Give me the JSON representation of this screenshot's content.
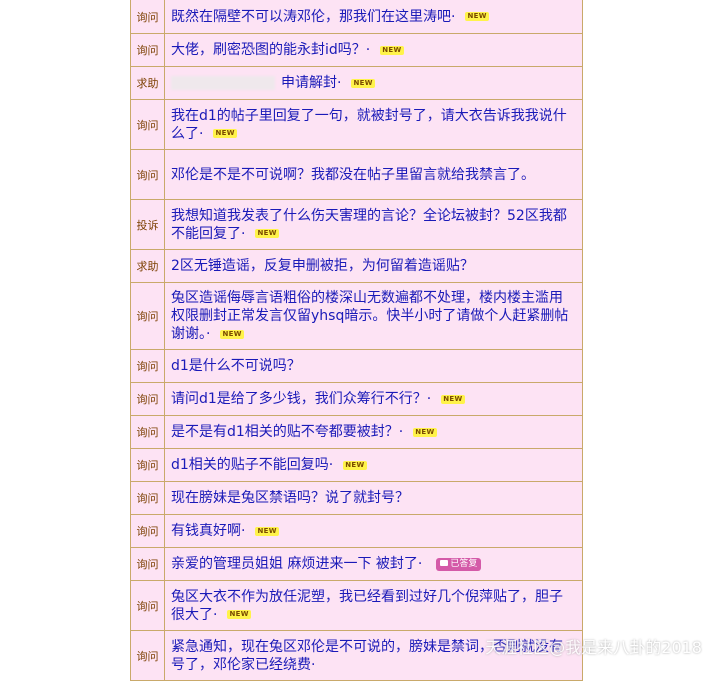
{
  "posts": [
    {
      "tag": "询问",
      "title": "既然在隔壁不可以涛邓伦，那我们在这里涛吧·",
      "new": "NEW",
      "h": 34
    },
    {
      "tag": "询问",
      "title": "大佬，刷密恐图的能永封id吗？·",
      "new": "NEW",
      "h": 33
    },
    {
      "tag": "求助",
      "title": "申请解封·",
      "new": "NEW",
      "h": 33,
      "blur": true
    },
    {
      "tag": "询问",
      "title": "我在d1的帖子里回复了一句，就被封号了，请大衣告诉我我说什么了·",
      "new": "NEW",
      "h": 50
    },
    {
      "tag": "询问",
      "title": "邓伦是不是不可说啊？我都没在帖子里留言就给我禁言了。",
      "new": "",
      "h": 50
    },
    {
      "tag": "投诉",
      "title": "我想知道我发表了什么伤天害理的言论？全论坛被封？52区我都不能回复了·",
      "new": "NEW",
      "h": 50
    },
    {
      "tag": "求助",
      "title": "2区无锤造谣，反复申删被拒，为何留着造谣贴？",
      "new": "",
      "h": 33
    },
    {
      "tag": "询问",
      "title": "兔区造谣侮辱言语粗俗的楼深山无数遍都不处理，楼内楼主滥用权限删封正常发言仅留yhsq暗示。快半小时了请做个人赶紧删帖谢谢。·",
      "new": "NEW",
      "h": 67
    },
    {
      "tag": "询问",
      "title": "d1是什么不可说吗？",
      "new": "",
      "h": 33
    },
    {
      "tag": "询问",
      "title": "请问d1是给了多少钱，我们众筹行不行？·",
      "new": "NEW",
      "h": 33
    },
    {
      "tag": "询问",
      "title": "是不是有d1相关的贴不夸都要被封？·",
      "new": "NEW",
      "h": 33
    },
    {
      "tag": "询问",
      "title": "d1相关的贴子不能回复吗·",
      "new": "NEW",
      "h": 33
    },
    {
      "tag": "询问",
      "title": "现在膀妹是兔区禁语吗？说了就封号？",
      "new": "",
      "h": 33
    },
    {
      "tag": "询问",
      "title": "有钱真好啊·",
      "new": "NEW",
      "h": 33
    },
    {
      "tag": "询问",
      "title": "亲爱的管理员姐姐 麻烦进来一下 被封了·",
      "new": "",
      "answered": "已答复",
      "h": 33
    },
    {
      "tag": "询问",
      "title": "兔区大衣不作为放任泥塑，我已经看到过好几个倪萍贴了，胆子很大了·",
      "new": "NEW",
      "h": 50
    },
    {
      "tag": "询问",
      "title": "紧急通知，现在兔区邓伦是不可说的，膀妹是禁词，否则就没有号了，邓伦家已经绕费·",
      "new": "",
      "h": 50
    }
  ],
  "watermark": "天涯社区@我是来八卦的2018"
}
